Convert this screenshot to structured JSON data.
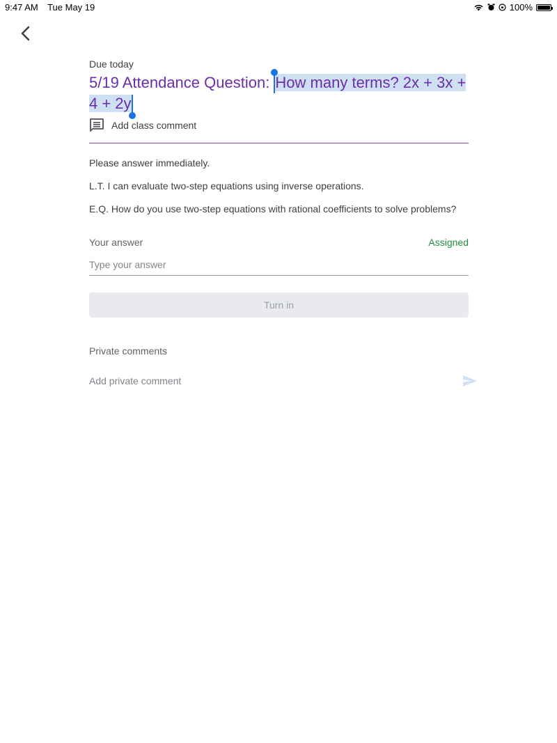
{
  "status_bar": {
    "time": "9:47 AM",
    "date": "Tue May 19",
    "battery_label": "100%",
    "battery_level": 1.0,
    "icons": [
      "wifi-icon",
      "alarm-icon",
      "orientation-lock-icon",
      "battery-icon"
    ]
  },
  "nav": {
    "back_icon": "chevron-left-icon"
  },
  "assignment": {
    "due": "Due today",
    "title_prefix": "5/19 Attendance Question: ",
    "title_selected_line1": "How many terms?    2x + 3x +",
    "title_selected_line2": "4 + 2y",
    "class_comment_label": "Add class comment",
    "description": [
      "Please answer immediately.",
      "L.T. I can evaluate two-step equations using inverse operations.",
      "E.Q. How do you use two-step equations with rational coefficients to solve problems?"
    ]
  },
  "answer": {
    "label": "Your answer",
    "status": "Assigned",
    "placeholder": "Type your answer",
    "value": "",
    "turn_in_label": "Turn in"
  },
  "private_comments": {
    "label": "Private comments",
    "placeholder": "Add private comment"
  },
  "colors": {
    "title": "#6a2dab",
    "selection": "#cfe0f3",
    "caret": "#1a73e8",
    "assigned": "#1e8e3e",
    "divider": "#8e44b8"
  }
}
